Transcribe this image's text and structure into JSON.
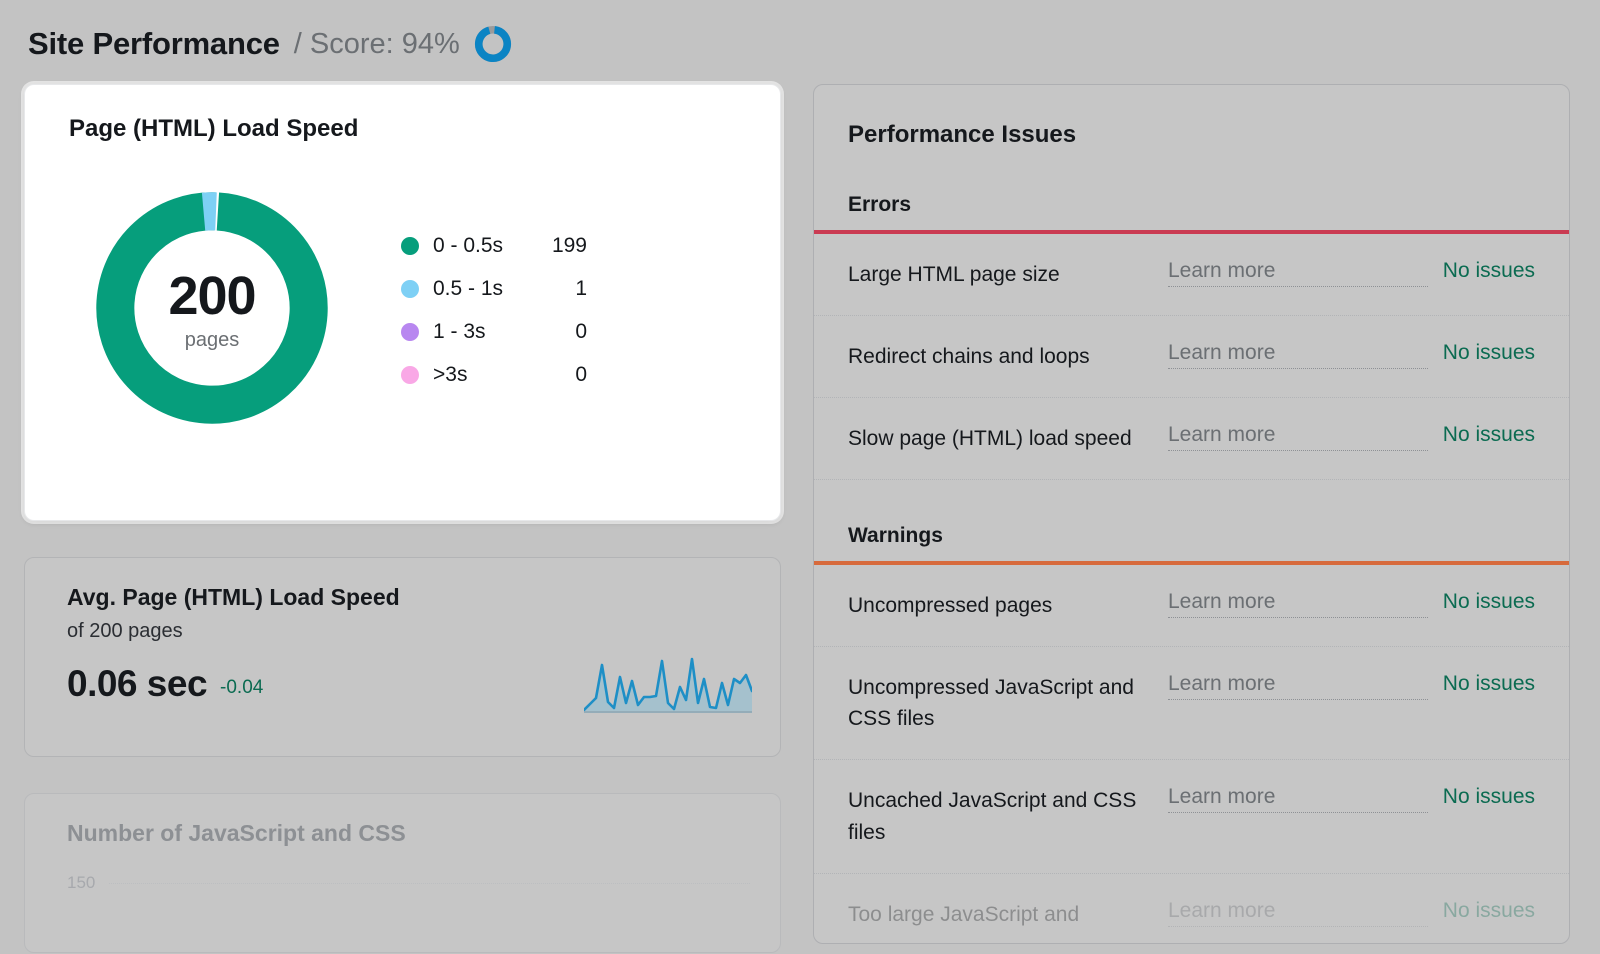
{
  "header": {
    "title": "Site Performance",
    "separator": "/",
    "score_label": "Score: 94%",
    "score_value": 94,
    "score_ring_icon": "circular-progress-icon",
    "score_ring_color": "#0b84c4"
  },
  "load_speed_card": {
    "title": "Page (HTML) Load Speed",
    "center_value": "200",
    "center_unit": "pages"
  },
  "chart_data": {
    "type": "pie",
    "title": "Page (HTML) Load Speed",
    "total": 200,
    "total_unit": "pages",
    "categories": [
      "0 - 0.5s",
      "0.5 - 1s",
      "1 - 3s",
      ">3s"
    ],
    "values": [
      199,
      1,
      0,
      0
    ],
    "colors": [
      "#069e7c",
      "#7ed0f5",
      "#b887f0",
      "#f9a8e6"
    ],
    "legend_position": "right",
    "grid": false,
    "xlabel": "",
    "ylabel": ""
  },
  "avg_speed_card": {
    "title": "Avg. Page (HTML) Load Speed",
    "subtitle": "of 200 pages",
    "value": "0.06 sec",
    "delta": "-0.04",
    "delta_color": "#0b6b51",
    "sparkline": {
      "type": "line",
      "values": [
        2,
        4,
        34,
        10,
        3,
        26,
        7,
        24,
        5,
        13,
        12,
        13,
        40,
        5,
        2,
        18,
        9,
        36,
        6,
        30,
        3,
        2,
        23,
        4,
        26,
        22,
        27,
        14
      ],
      "line_color": "#1e8fc6",
      "fill_color": "#9fc0ce"
    }
  },
  "js_css_card": {
    "title": "Number of JavaScript and CSS",
    "axis_label": "150"
  },
  "issues_panel": {
    "title": "Performance Issues",
    "learn_more_label": "Learn more",
    "sections": [
      {
        "heading": "Errors",
        "rule_color": "#ca3b52",
        "rows": [
          {
            "name": "Large HTML page size",
            "learn_more": "Learn more",
            "status": "No issues",
            "faded": false
          },
          {
            "name": "Redirect chains and loops",
            "learn_more": "Learn more",
            "status": "No issues",
            "faded": false
          },
          {
            "name": "Slow page (HTML) load speed",
            "learn_more": "Learn more",
            "status": "No issues",
            "faded": false
          }
        ]
      },
      {
        "heading": "Warnings",
        "rule_color": "#d76a3c",
        "rows": [
          {
            "name": "Uncompressed pages",
            "learn_more": "Learn more",
            "status": "No issues",
            "faded": false
          },
          {
            "name": "Uncompressed JavaScript and CSS files",
            "learn_more": "Learn more",
            "status": "No issues",
            "faded": false
          },
          {
            "name": "Uncached JavaScript and CSS files",
            "learn_more": "Learn more",
            "status": "No issues",
            "faded": false
          },
          {
            "name": "Too large JavaScript and",
            "learn_more": "Learn more",
            "status": "No issues",
            "faded": true
          }
        ]
      }
    ]
  }
}
